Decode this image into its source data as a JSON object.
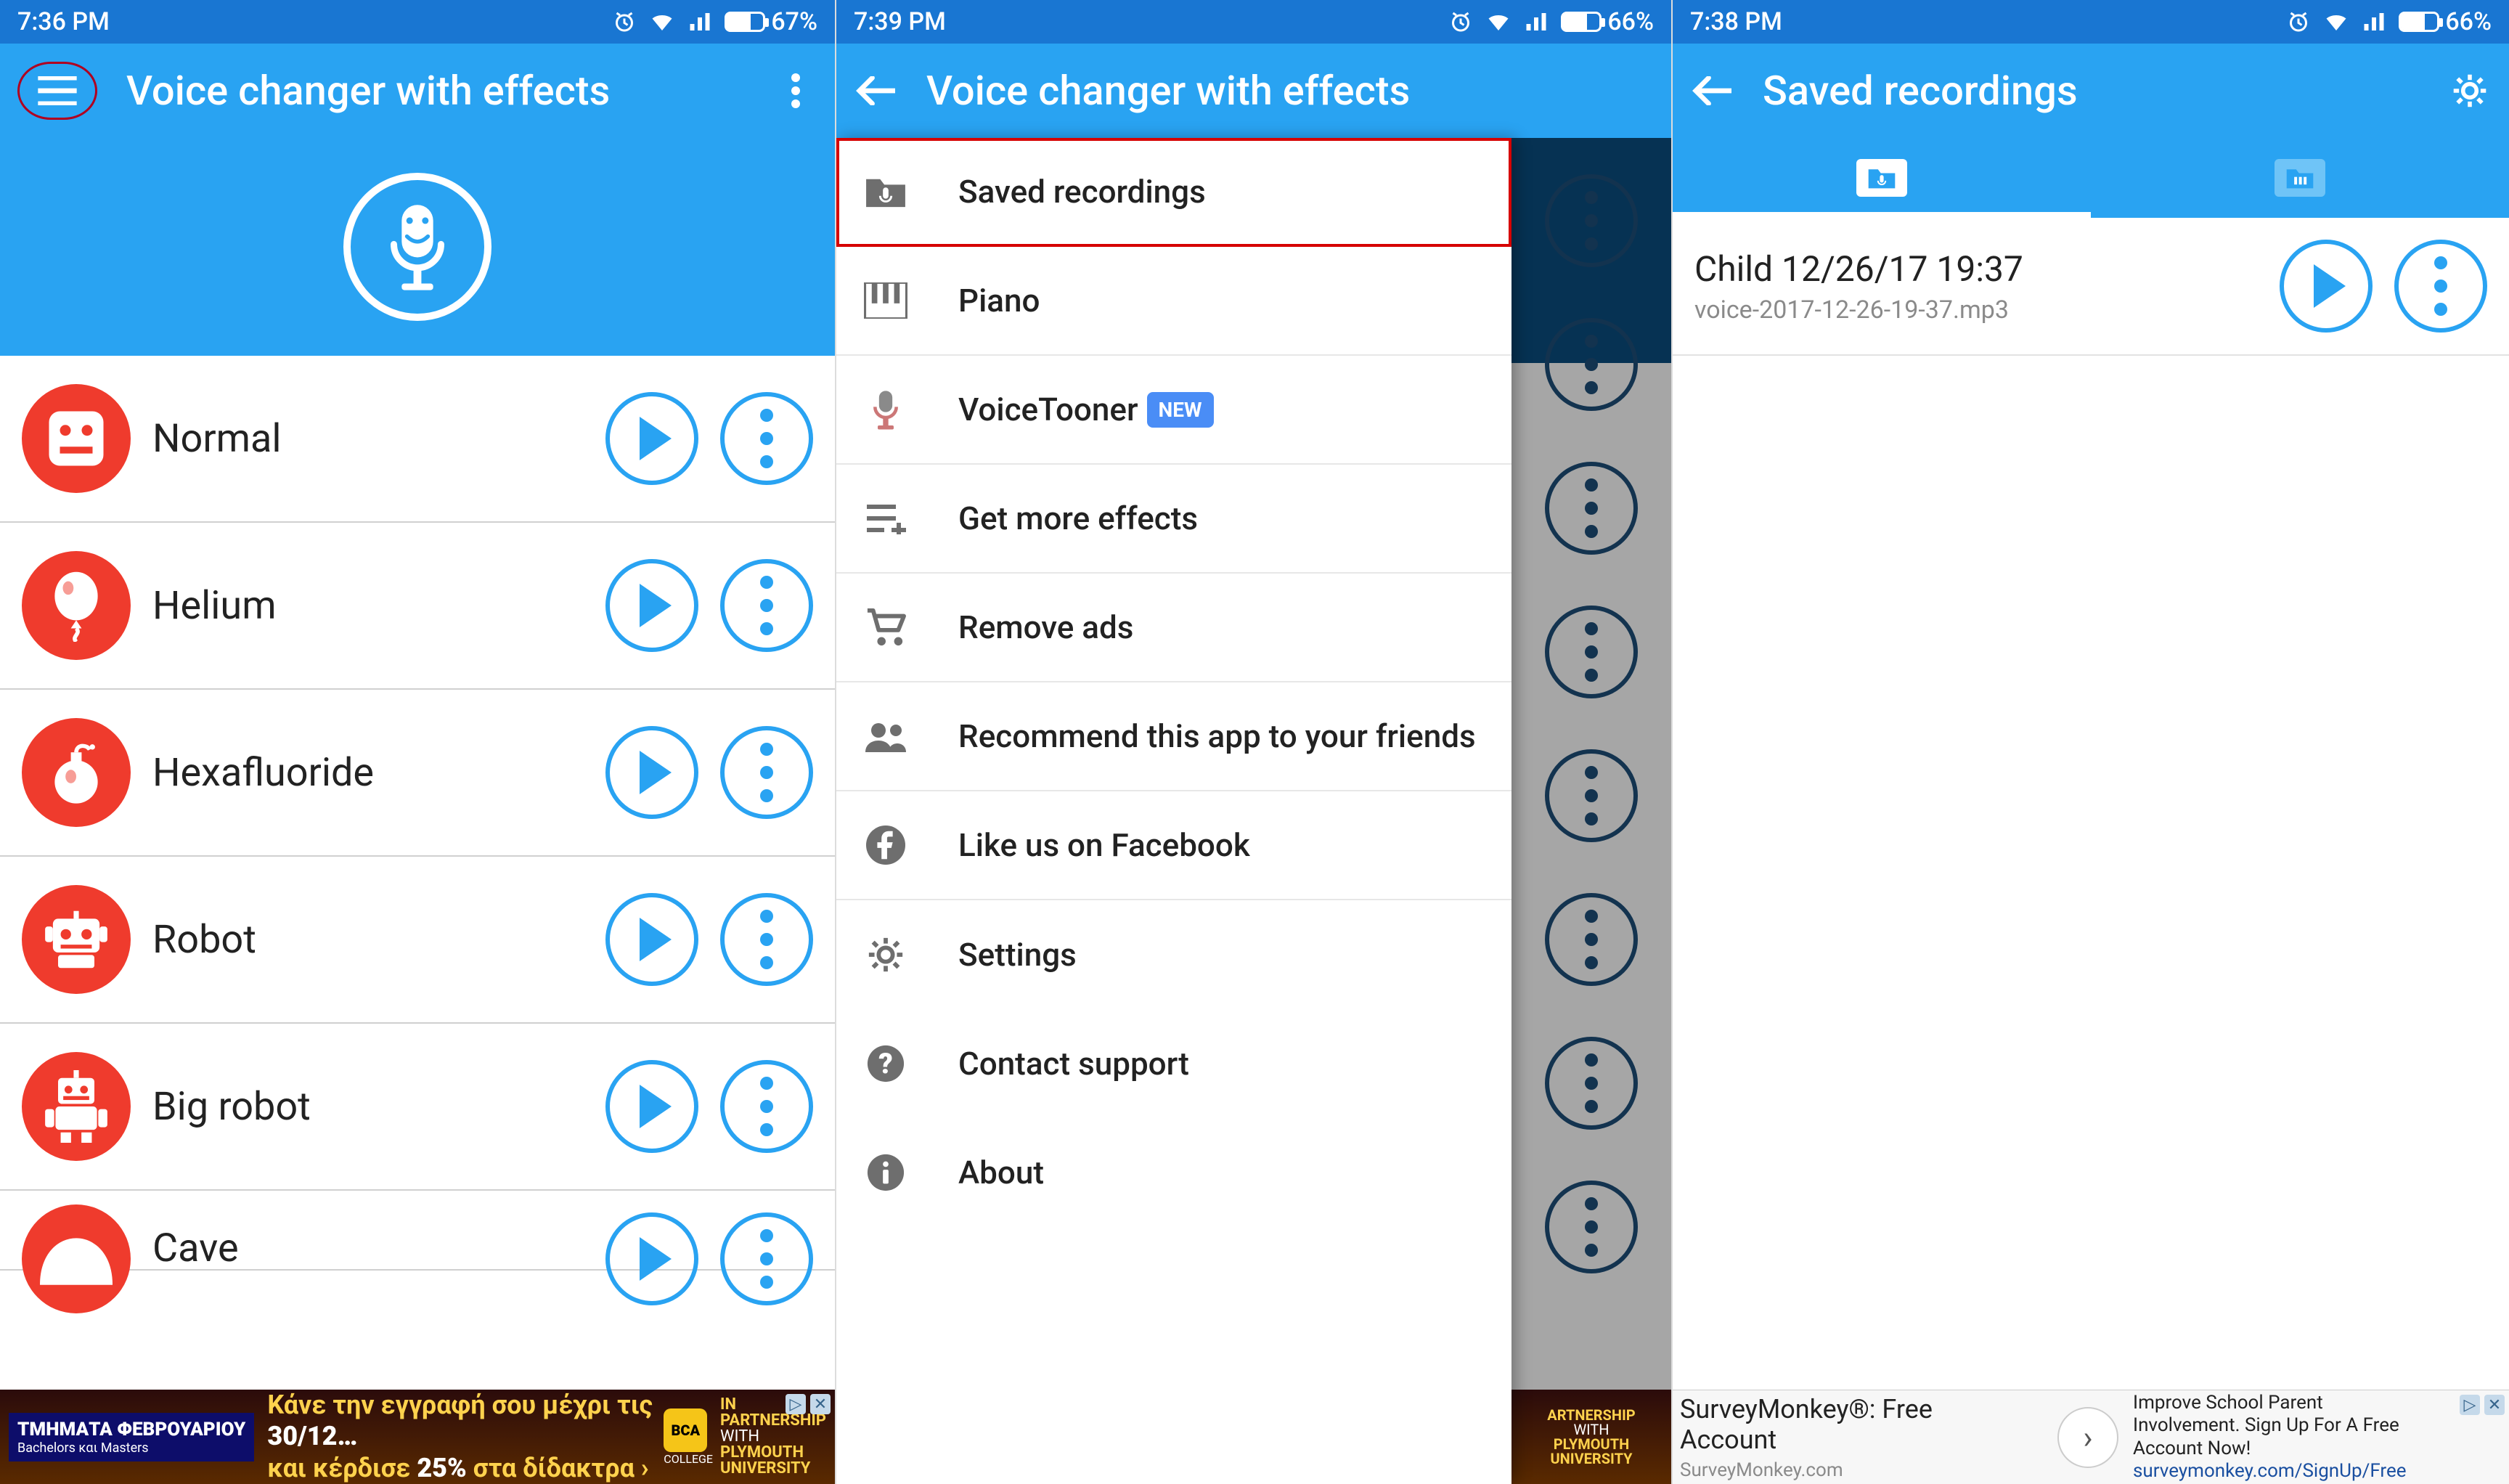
{
  "colors": {
    "brand": "#29a3f2",
    "statusbar": "#1976d2",
    "accent_red": "#ef3b2d",
    "highlight": "#d60000"
  },
  "screen1": {
    "status": {
      "time": "7:36 PM",
      "battery": "67%"
    },
    "title": "Voice changer with effects",
    "effects": [
      {
        "id": "normal",
        "label": "Normal"
      },
      {
        "id": "helium",
        "label": "Helium"
      },
      {
        "id": "hexafluoride",
        "label": "Hexafluoride"
      },
      {
        "id": "robot",
        "label": "Robot"
      },
      {
        "id": "big-robot",
        "label": "Big robot"
      }
    ],
    "cutoff_effect": {
      "id": "cave",
      "label_partial": "Cave"
    },
    "ad": {
      "left": "ΤΜΗΜΑΤΑ ΦΕΒΡΟΥΑΡΙΟΥ",
      "left_sub": "Bachelors και Masters",
      "line1_a": "Κάνε την εγγραφή σου μέχρι τις ",
      "line1_b": "30/12…",
      "line2_a": "και κέρδισε ",
      "line2_b": "25%",
      "line2_c": " στα δίδακτρα ›",
      "bca": "BCA",
      "bca_sub": "COLLEGE",
      "partner1": "IN",
      "partner2": "PARTNERSHIP",
      "partner3": "WITH",
      "partner4": "PLYMOUTH",
      "partner5": "UNIVERSITY",
      "adchoices": "▷",
      "close": "✕"
    }
  },
  "screen2": {
    "status": {
      "time": "7:39 PM",
      "battery": "66%"
    },
    "title": "Voice changer with effects",
    "drawer": [
      {
        "id": "saved-recordings",
        "label": "Saved recordings",
        "selected": true
      },
      {
        "id": "piano",
        "label": "Piano"
      },
      {
        "id": "voicetooner",
        "label": "VoiceTooner",
        "badge": "NEW"
      },
      {
        "id": "more-effects",
        "label": "Get more effects"
      },
      {
        "id": "remove-ads",
        "label": "Remove ads"
      },
      {
        "id": "recommend",
        "label": "Recommend this app to your friends"
      },
      {
        "id": "facebook",
        "label": "Like us on Facebook"
      },
      {
        "id": "settings",
        "label": "Settings"
      },
      {
        "id": "support",
        "label": "Contact support"
      },
      {
        "id": "about",
        "label": "About"
      }
    ],
    "ad_sliver": {
      "l1": "ARTNERSHIP",
      "l2": "WITH",
      "l3": "PLYMOUTH",
      "l4": "UNIVERSITY"
    }
  },
  "screen3": {
    "status": {
      "time": "7:38 PM",
      "battery": "66%"
    },
    "title": "Saved recordings",
    "tabs": {
      "active": "voice",
      "inactive": "piano"
    },
    "recording": {
      "title": "Child 12/26/17 19:37",
      "file": "voice-2017-12-26-19-37.mp3"
    },
    "ad": {
      "head1": "SurveyMonkey®: Free",
      "head2": "Account",
      "domain": "SurveyMonkey.com",
      "desc1": "Improve School Parent",
      "desc2": "Involvement. Sign Up For A Free",
      "desc3": "Account Now!",
      "url": "surveymonkey.com/SignUp/Free",
      "adchoices": "▷",
      "close": "✕"
    }
  }
}
